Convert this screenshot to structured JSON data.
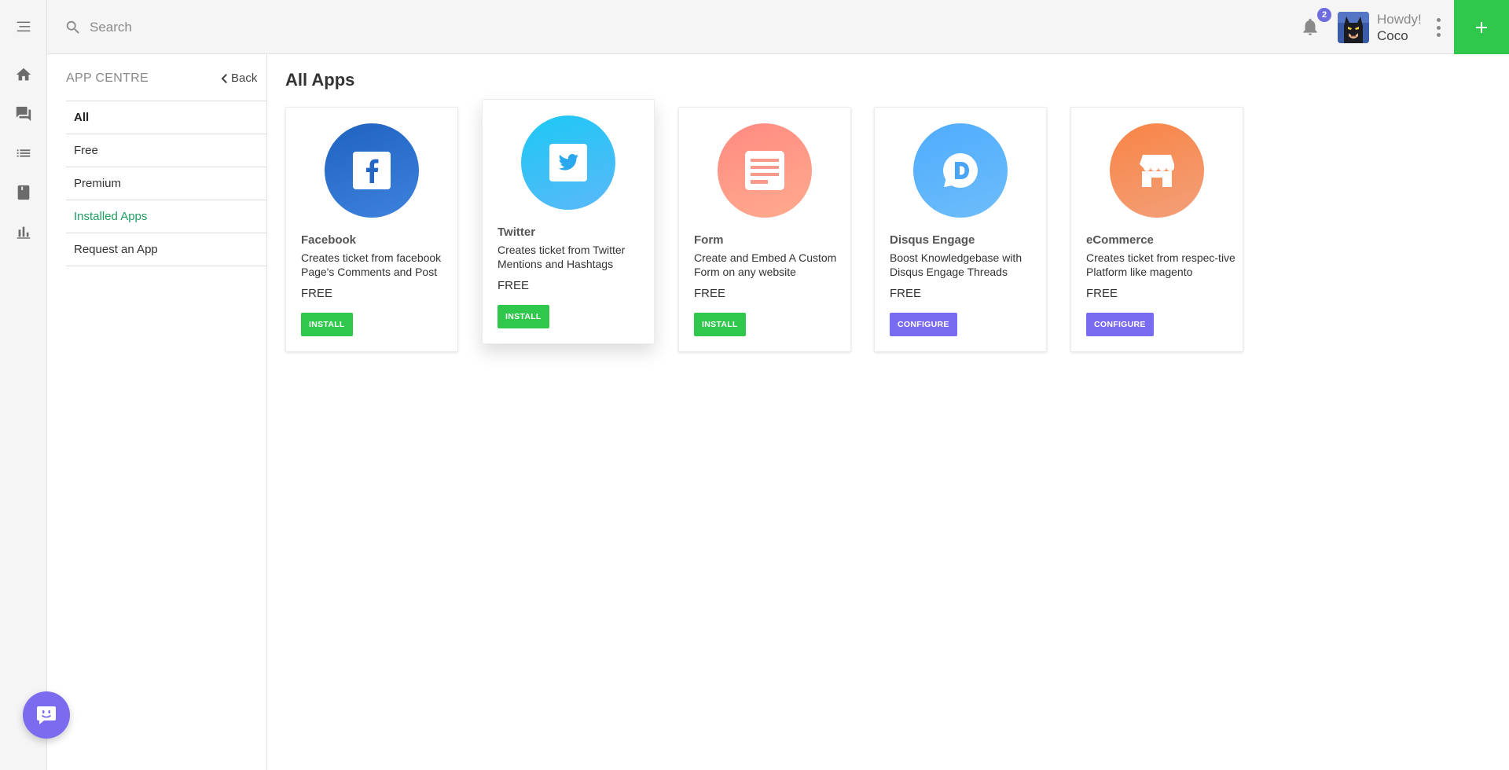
{
  "search": {
    "placeholder": "Search"
  },
  "header": {
    "notification_count": "2",
    "greeting": "Howdy!",
    "username": "Coco",
    "accent_color": "#2fc84c"
  },
  "rail": {
    "items": [
      "menu-icon",
      "home-icon",
      "tickets-icon",
      "list-icon",
      "knowledgebase-icon",
      "reports-icon"
    ]
  },
  "subnav": {
    "title": "APP CENTRE",
    "back_label": "Back",
    "items": [
      {
        "label": "All"
      },
      {
        "label": "Free"
      },
      {
        "label": "Premium"
      },
      {
        "label": "Installed Apps"
      },
      {
        "label": "Request an App"
      }
    ]
  },
  "main": {
    "title": "All Apps",
    "apps": [
      {
        "name": "Facebook",
        "description": "Creates ticket from facebook Page's Comments and Post",
        "price": "FREE",
        "action": "INSTALL",
        "icon": "facebook-icon",
        "colors": [
          "#1f63c0",
          "#3d82dd"
        ]
      },
      {
        "name": "Twitter",
        "description": "Creates ticket from Twitter Mentions and Hashtags",
        "price": "FREE",
        "action": "INSTALL",
        "icon": "twitter-icon",
        "colors": [
          "#1cc8f5",
          "#5bb8f8"
        ]
      },
      {
        "name": "Form",
        "description": "Create and Embed A Custom Form on any website",
        "price": "FREE",
        "action": "INSTALL",
        "icon": "form-icon",
        "colors": [
          "#ff8a80",
          "#ffab8f"
        ]
      },
      {
        "name": "Disqus Engage",
        "description": "Boost Knowledgebase with Disqus Engage Threads",
        "price": "FREE",
        "action": "CONFIGURE",
        "icon": "disqus-icon",
        "colors": [
          "#4facfe",
          "#6dbdf9"
        ]
      },
      {
        "name": "eCommerce",
        "description": "Creates ticket from respec-tive Platform like magento",
        "price": "FREE",
        "action": "CONFIGURE",
        "icon": "store-icon",
        "colors": [
          "#f98445",
          "#f2a07a"
        ]
      }
    ]
  }
}
